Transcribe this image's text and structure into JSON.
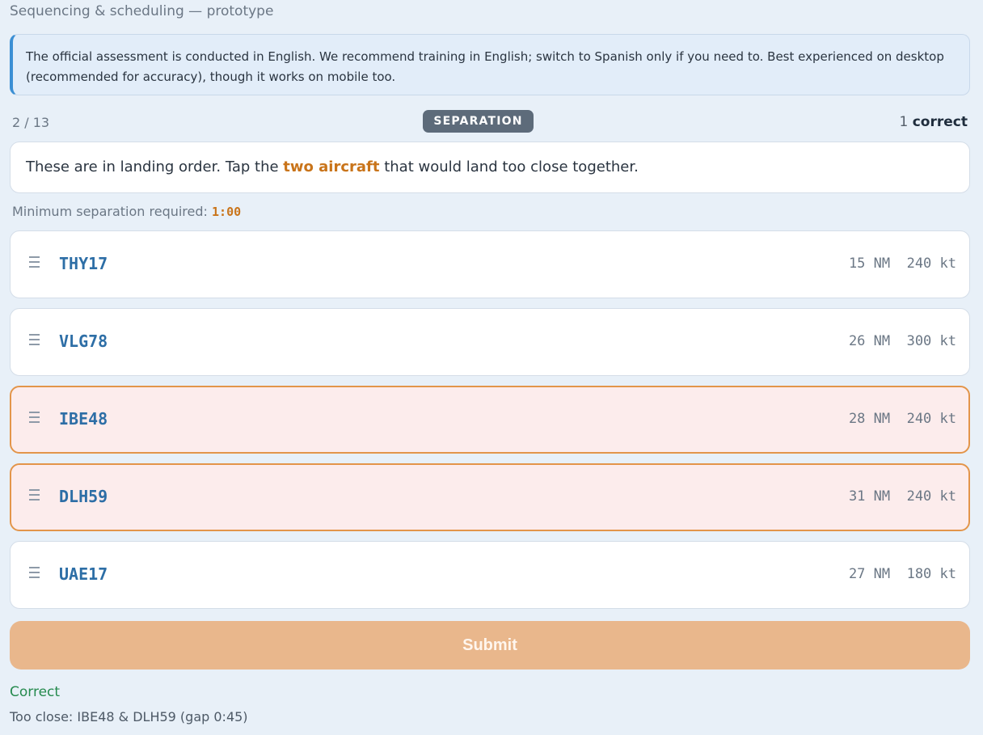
{
  "app": {
    "title": "Sequencing & scheduling — prototype"
  },
  "notice": {
    "text": "The official assessment is conducted in English. We recommend training in English; switch to Spanish only if you need to. Best experienced on desktop (recommended for accuracy), though it works on mobile too."
  },
  "status": {
    "progress": "2 / 13",
    "mode": "SEPARATION",
    "score_count": "1",
    "score_label": "correct"
  },
  "question": {
    "before": "These are in landing order. Tap the ",
    "highlight": "two aircraft",
    "after": " that would land too close together."
  },
  "separation": {
    "label": "Minimum separation required: ",
    "value": "1:00"
  },
  "aircraft": [
    {
      "callsign": "THY17",
      "metrics": "15 NM  240 kt",
      "flagged": false
    },
    {
      "callsign": "VLG78",
      "metrics": "26 NM  300 kt",
      "flagged": false
    },
    {
      "callsign": "IBE48",
      "metrics": "28 NM  240 kt",
      "flagged": true
    },
    {
      "callsign": "DLH59",
      "metrics": "31 NM  240 kt",
      "flagged": true
    },
    {
      "callsign": "UAE17",
      "metrics": "27 NM  180 kt",
      "flagged": false
    }
  ],
  "actions": {
    "submit_label": "Submit"
  },
  "result": {
    "title": "Correct",
    "detail": "Too close: IBE48 & DLH59 (gap 0:45)"
  },
  "colors": {
    "accent": "#c9741a",
    "callsign": "#2d6ea6",
    "flag_border": "#e3954a",
    "flag_fill": "#fcecec",
    "success": "#258a4e",
    "submit": "#e9b78c"
  },
  "icons": {
    "drag_handle": "grip-lines-icon"
  }
}
